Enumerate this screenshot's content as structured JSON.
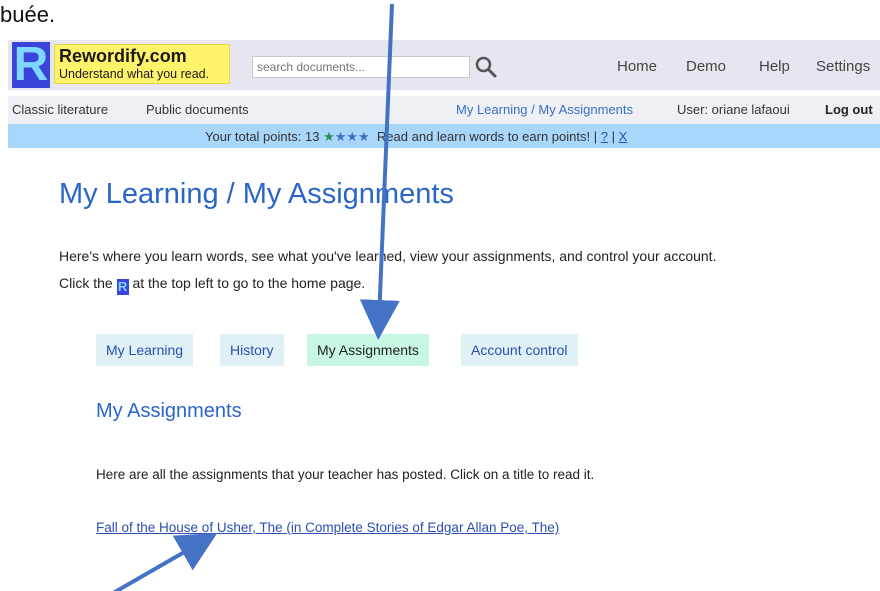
{
  "document": {
    "caption": "buée."
  },
  "header": {
    "logo_letter": "R",
    "brand": "Rewordify.com",
    "tagline": "Understand what you read.",
    "search_placeholder": "search documents...",
    "nav": [
      "Home",
      "Demo",
      "Help",
      "Settings"
    ]
  },
  "subnav": {
    "classic": "Classic literature",
    "public": "Public documents",
    "my_learning": "My Learning / My Assignments",
    "user": "User: oriane lafaoui",
    "logout": "Log out"
  },
  "points": {
    "prefix": "Your total points: 13",
    "stars_green": "★",
    "stars_blue": "★★★",
    "message": "Read and learn words to earn points!",
    "sep1": "|",
    "help": "?",
    "sep2": "|",
    "close": "X"
  },
  "main": {
    "title": "My Learning / My Assignments",
    "intro_line1": "Here's where you learn words, see what you've learned, view your assignments, and control your account.",
    "intro_line2_pre": "Click the",
    "intro_icon": "R",
    "intro_line2_post": "at the top left to go to the home page.",
    "tabs": [
      "My Learning",
      "History",
      "My Assignments",
      "Account control"
    ],
    "active_tab": "My Assignments",
    "section_title": "My Assignments",
    "section_desc": "Here are all the assignments that your teacher has posted. Click on a title to read it.",
    "assignment": "Fall of the House of Usher, The (in Complete Stories of Edgar Allan Poe, The)"
  },
  "colors": {
    "brand_blue": "#3a44d9",
    "logo_yellow": "#fff36b",
    "points_bar": "#a9d6fb",
    "title_blue": "#2a66c9",
    "arrow_blue": "#4472c4"
  }
}
